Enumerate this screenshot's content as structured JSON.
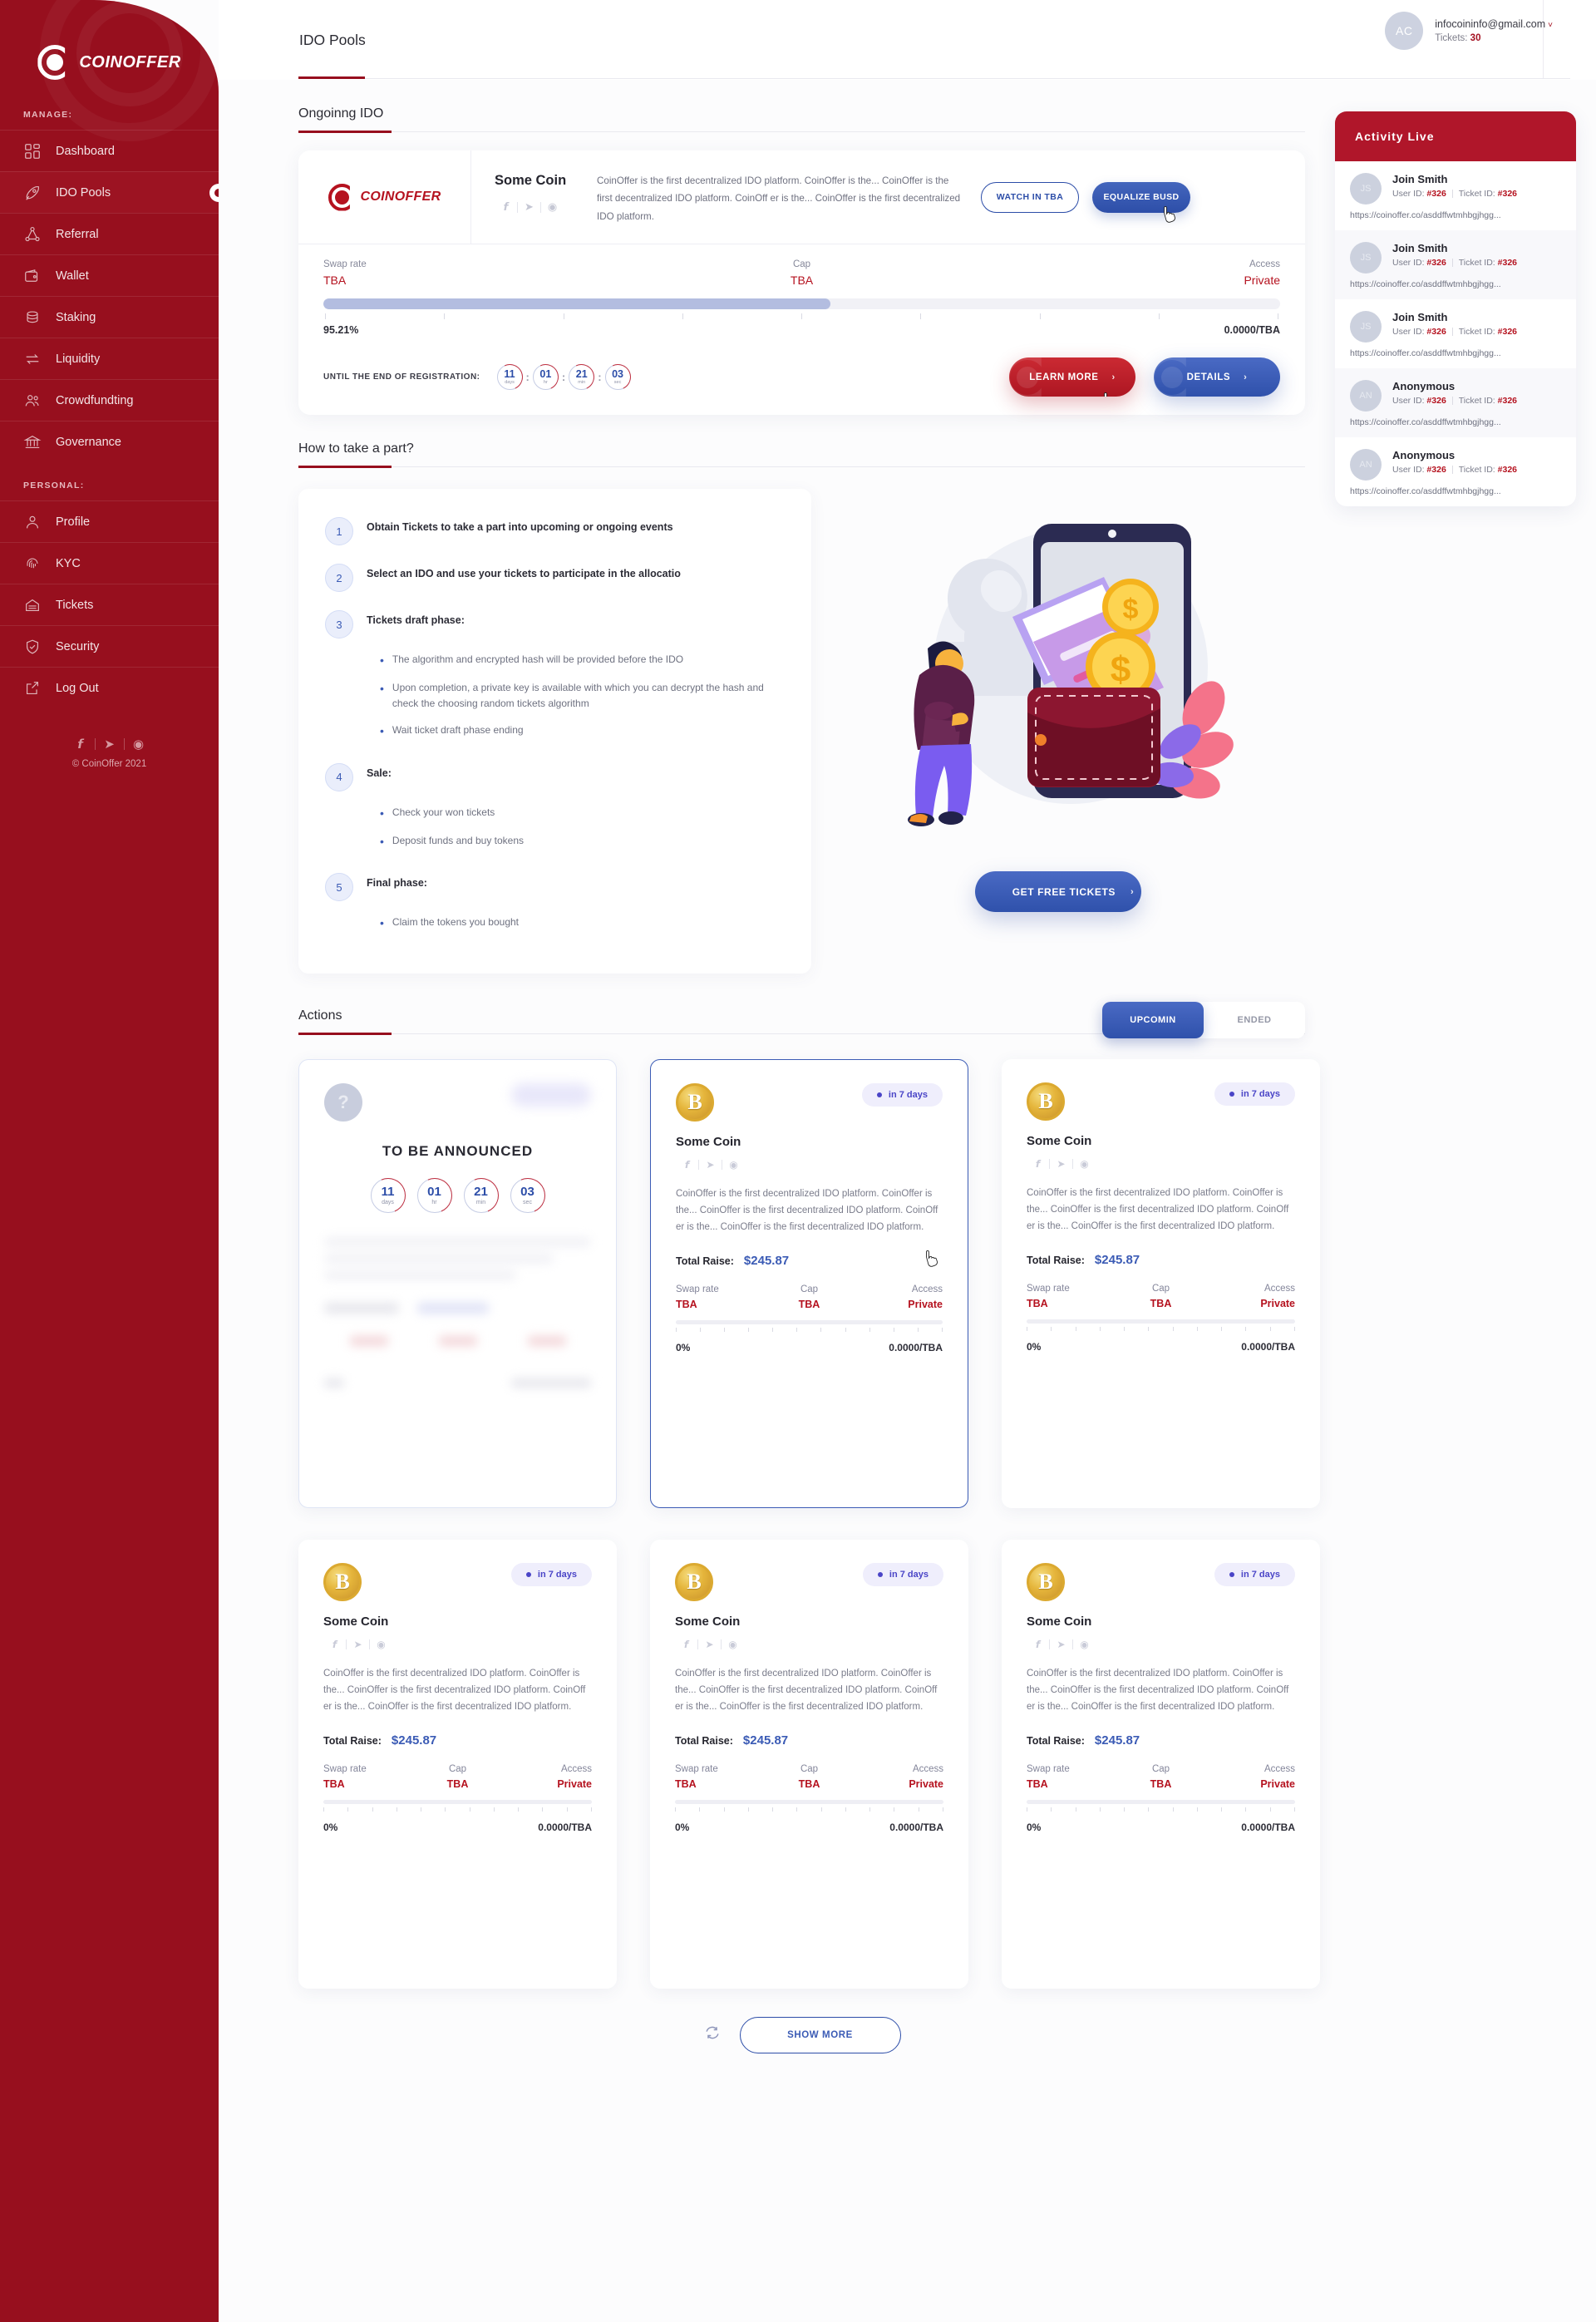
{
  "brand": {
    "name": "COINOFFER",
    "accent_red": "#970f1e",
    "accent_blue": "#2f51ab"
  },
  "sidebar": {
    "manage_label": "MANAGE:",
    "personal_label": "PERSONAL:",
    "manage_items": [
      {
        "label": "Dashboard",
        "icon": "grid-icon"
      },
      {
        "label": "IDO Pools",
        "icon": "rocket-icon"
      },
      {
        "label": "Referral",
        "icon": "referral-network-icon"
      },
      {
        "label": "Wallet",
        "icon": "wallet-icon"
      },
      {
        "label": "Staking",
        "icon": "coins-stack-icon"
      },
      {
        "label": "Liquidity",
        "icon": "swap-arrows-icon"
      },
      {
        "label": "Crowdfundting",
        "icon": "people-icon"
      },
      {
        "label": "Governance",
        "icon": "bank-icon"
      }
    ],
    "personal_items": [
      {
        "label": "Profile",
        "icon": "user-icon"
      },
      {
        "label": "KYC",
        "icon": "fingerprint-icon"
      },
      {
        "label": "Tickets",
        "icon": "ticket-icon"
      },
      {
        "label": "Security",
        "icon": "shield-check-icon"
      },
      {
        "label": "Log Out",
        "icon": "logout-icon"
      }
    ],
    "socials": [
      "facebook-icon",
      "telegram-icon",
      "instagram-icon"
    ],
    "copyright": "© CoinOffer 2021"
  },
  "header": {
    "title": "IDO Pools",
    "avatar_initials": "AC",
    "email": "infocoininfo@gmail.com",
    "caret": "˅",
    "tickets_label": "Tickets:",
    "tickets_value": "30"
  },
  "ongoing": {
    "section_title": "Ongoinng IDO",
    "logo_text": "COINOFFER",
    "coin_name": "Some Coin",
    "socials": [
      "facebook-icon",
      "telegram-icon",
      "instagram-icon"
    ],
    "description": "CoinOffer is the first decentralized IDO platform. CoinOffer is the... CoinOffer is the first decentralized IDO platform. CoinOff er is the... CoinOffer is the first decentralized IDO platform.",
    "watch_button": "WATCH IN TBA",
    "equalize_button": "EQUALIZE BUSD",
    "stats": [
      {
        "key": "Swap rate",
        "value": "TBA"
      },
      {
        "key": "Cap",
        "value": "TBA"
      },
      {
        "key": "Access",
        "value": "Private"
      }
    ],
    "progress_percent": 95.21,
    "progress_bar_fill_percent": 53,
    "progress_left_label": "95.21%",
    "progress_right_label": "0.0000/TBA",
    "countdown_label": "UNTIL THE END OF REGISTRATION:",
    "countdown": [
      {
        "value": "11",
        "unit": "days"
      },
      {
        "value": "01",
        "unit": "hr"
      },
      {
        "value": "21",
        "unit": "min"
      },
      {
        "value": "03",
        "unit": "sec"
      }
    ],
    "learn_more_button": "LEARN MORE",
    "details_button": "DETAILS",
    "chevron": "›"
  },
  "howto": {
    "section_title": "How to take a part?",
    "steps": [
      {
        "n": "1",
        "text": "Obtain Tickets to take a part into upcoming or ongoing events",
        "bullets": []
      },
      {
        "n": "2",
        "text": "Select an IDO and use your tickets to participate in the allocatio",
        "bullets": []
      },
      {
        "n": "3",
        "text": "Tickets draft phase:",
        "bullets": [
          "The algorithm and encrypted hash will be provided before the IDO",
          "Upon completion, a private key is available with which you can decrypt the hash and check the choosing random tickets algorithm",
          "Wait ticket draft phase ending"
        ]
      },
      {
        "n": "4",
        "text": "Sale:",
        "bullets": [
          "Check your won tickets",
          "Deposit funds and buy tokens"
        ]
      },
      {
        "n": "5",
        "text": "Final phase:",
        "bullets": [
          "Claim the tokens you bought"
        ]
      }
    ],
    "illustration": "wallet-phone-coins-illustration",
    "cta_button": "GET FREE TICKETS",
    "cta_chevron": "›"
  },
  "actions": {
    "section_title": "Actions",
    "tabs": [
      {
        "label": "UPCOMIN",
        "active": true
      },
      {
        "label": "ENDED",
        "active": false
      }
    ],
    "tba_card": {
      "question_mark": "?",
      "title": "TO BE ANNOUNCED",
      "countdown": [
        {
          "value": "11",
          "unit": "days"
        },
        {
          "value": "01",
          "unit": "hr"
        },
        {
          "value": "21",
          "unit": "min"
        },
        {
          "value": "03",
          "unit": "sec"
        }
      ]
    },
    "tile": {
      "coin_glyph": "B",
      "badge": "in 7 days",
      "name": "Some Coin",
      "socials": [
        "facebook-icon",
        "telegram-icon",
        "instagram-icon"
      ],
      "description": "CoinOffer is the first decentralized IDO platform. CoinOffer is the... CoinOffer is the first decentralized IDO platform. CoinOff er is the... CoinOffer is the first decentralized IDO platform.",
      "raise_label": "Total Raise:",
      "raise_value": "$245.87",
      "stats": [
        {
          "key": "Swap rate",
          "value": "TBA"
        },
        {
          "key": "Cap",
          "value": "TBA"
        },
        {
          "key": "Access",
          "value": "Private"
        }
      ],
      "progress_left": "0%",
      "progress_right": "0.0000/TBA"
    },
    "refresh_icon": "refresh-icon",
    "show_more_button": "SHOW MORE"
  },
  "activity": {
    "title": "Activity Live",
    "items": [
      {
        "initials": "JS",
        "name": "Join Smith",
        "user_id_label": "User ID:",
        "user_id": "#326",
        "ticket_id_label": "Ticket ID:",
        "ticket_id": "#326",
        "url": "https://coinoffer.co/asddffwtmhbgjhgg..."
      },
      {
        "initials": "JS",
        "name": "Join Smith",
        "user_id_label": "User ID:",
        "user_id": "#326",
        "ticket_id_label": "Ticket ID:",
        "ticket_id": "#326",
        "url": "https://coinoffer.co/asddffwtmhbgjhgg..."
      },
      {
        "initials": "JS",
        "name": "Join Smith",
        "user_id_label": "User ID:",
        "user_id": "#326",
        "ticket_id_label": "Ticket ID:",
        "ticket_id": "#326",
        "url": "https://coinoffer.co/asddffwtmhbgjhgg..."
      },
      {
        "initials": "AN",
        "name": "Anonymous",
        "user_id_label": "User ID:",
        "user_id": "#326",
        "ticket_id_label": "Ticket ID:",
        "ticket_id": "#326",
        "url": "https://coinoffer.co/asddffwtmhbgjhgg..."
      },
      {
        "initials": "AN",
        "name": "Anonymous",
        "user_id_label": "User ID:",
        "user_id": "#326",
        "ticket_id_label": "Ticket ID:",
        "ticket_id": "#326",
        "url": "https://coinoffer.co/asddffwtmhbgjhgg..."
      }
    ]
  }
}
